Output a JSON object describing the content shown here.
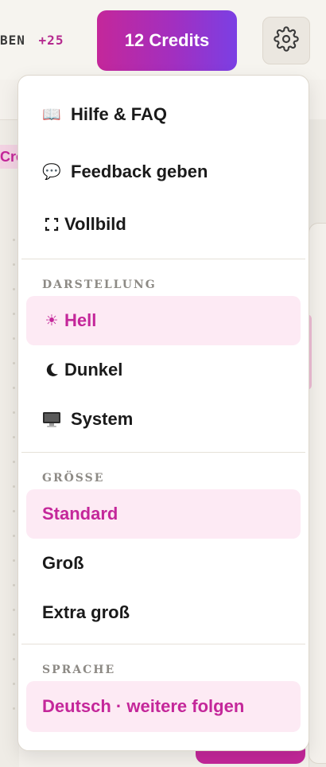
{
  "header": {
    "ticker_label": "BEN",
    "ticker_bonus": "+25",
    "credits_label": "12 Credits",
    "settings_icon": "gear-icon"
  },
  "background": {
    "chip_text": "Cre"
  },
  "menu": {
    "top_items": [
      {
        "icon": "book-icon",
        "icon_glyph": "📖",
        "label": "Hilfe & FAQ"
      },
      {
        "icon": "speech-bubble-icon",
        "icon_glyph": "💬",
        "label": "Feedback geben"
      },
      {
        "icon": "fullscreen-icon",
        "icon_glyph": "⛶",
        "label": "Vollbild"
      }
    ],
    "appearance": {
      "section_label": "DARSTELLUNG",
      "options": [
        {
          "icon": "sun-icon",
          "icon_glyph": "☀",
          "label": "Hell",
          "selected": true
        },
        {
          "icon": "moon-icon",
          "icon_glyph": "⏾",
          "label": "Dunkel",
          "selected": false
        },
        {
          "icon": "monitor-icon",
          "icon_glyph": "🖥",
          "label": "System",
          "selected": false
        }
      ]
    },
    "size": {
      "section_label": "GRÖSSE",
      "options": [
        {
          "label": "Standard",
          "selected": true
        },
        {
          "label": "Groß",
          "selected": false
        },
        {
          "label": "Extra groß",
          "selected": false
        }
      ]
    },
    "language": {
      "section_label": "SPRACHE",
      "current": "Deutsch · weitere folgen"
    }
  },
  "colors": {
    "accent": "#c4279a",
    "accent_bg": "#fdeaf4",
    "gradient_start": "#c4279a",
    "gradient_end": "#7b3fe4"
  }
}
